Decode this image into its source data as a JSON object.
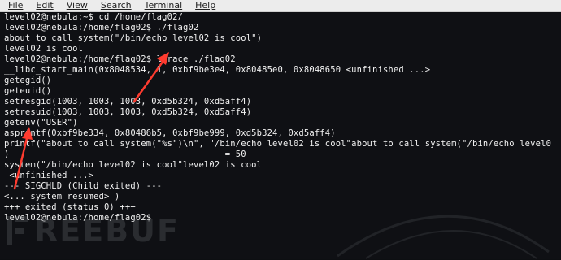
{
  "menubar": {
    "items": [
      "File",
      "Edit",
      "View",
      "Search",
      "Terminal",
      "Help"
    ]
  },
  "terminal": {
    "lines": [
      "level02@nebula:~$ cd /home/flag02/",
      "level02@nebula:/home/flag02$ ./flag02",
      "about to call system(\"/bin/echo level02 is cool\")",
      "level02 is cool",
      "level02@nebula:/home/flag02$ ltrace ./flag02",
      "__libc_start_main(0x8048534, 1, 0xbf9be3e4, 0x80485e0, 0x8048650 <unfinished ...>",
      "getegid()",
      "geteuid()",
      "setresgid(1003, 1003, 1003, 0xd5b324, 0xd5aff4)",
      "setresuid(1003, 1003, 1003, 0xd5b324, 0xd5aff4)",
      "getenv(\"USER\")",
      "asprintf(0xbf9be334, 0x80486b5, 0xbf9be999, 0xd5b324, 0xd5aff4)",
      "printf(\"about to call system(\"%s\")\\n\", \"/bin/echo level02 is cool\"about to call system(\"/bin/echo level0",
      ")                                         = 50",
      "system(\"/bin/echo level02 is cool\"level02 is cool",
      " <unfinished ...>",
      "--- SIGCHLD (Child exited) ---",
      "<... system resumed> )",
      "+++ exited (status 0) +++",
      "level02@nebula:/home/flag02$"
    ]
  },
  "watermark": {
    "text": "REEBUF"
  },
  "colors": {
    "terminal_bg": "#0f1014",
    "text": "#f2f2f2",
    "menubar_bg": "#ececec",
    "arrow": "#ff3b2f"
  }
}
